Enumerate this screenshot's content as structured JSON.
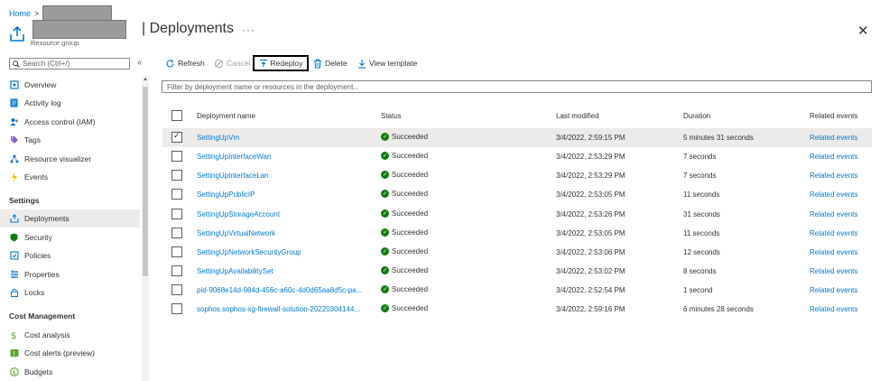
{
  "breadcrumb": {
    "home": "Home",
    "separator": ">"
  },
  "header": {
    "title": "| Deployments",
    "subtitle": "Resource group",
    "more": "···",
    "close": "✕"
  },
  "sidebar": {
    "search_placeholder": "Search (Ctrl+/)",
    "collapse": "«",
    "items_top": [
      {
        "label": "Overview",
        "icon": "overview-icon"
      },
      {
        "label": "Activity log",
        "icon": "activity-log-icon"
      },
      {
        "label": "Access control (IAM)",
        "icon": "access-control-icon"
      },
      {
        "label": "Tags",
        "icon": "tag-icon"
      },
      {
        "label": "Resource visualizer",
        "icon": "visualizer-icon"
      },
      {
        "label": "Events",
        "icon": "events-icon"
      }
    ],
    "section_settings": "Settings",
    "items_settings": [
      {
        "label": "Deployments",
        "icon": "deployments-icon"
      },
      {
        "label": "Security",
        "icon": "security-icon"
      },
      {
        "label": "Policies",
        "icon": "policies-icon"
      },
      {
        "label": "Properties",
        "icon": "properties-icon"
      },
      {
        "label": "Locks",
        "icon": "lock-icon"
      }
    ],
    "section_cost": "Cost Management",
    "items_cost": [
      {
        "label": "Cost analysis",
        "icon": "cost-analysis-icon"
      },
      {
        "label": "Cost alerts (preview)",
        "icon": "cost-alerts-icon"
      },
      {
        "label": "Budgets",
        "icon": "budgets-icon"
      }
    ]
  },
  "toolbar": {
    "refresh": "Refresh",
    "cancel": "Cancel",
    "redeploy": "Redeploy",
    "delete": "Delete",
    "view_template": "View template"
  },
  "filter_placeholder": "Filter by deployment name or resources in the deployment...",
  "table": {
    "columns": [
      "Deployment name",
      "Status",
      "Last modified",
      "Duration",
      "Related events"
    ],
    "rows": [
      {
        "name": "SettingUpVm",
        "status": "Succeeded",
        "modified": "3/4/2022, 2:59:15 PM",
        "duration": "5 minutes 31 seconds",
        "events": "Related events",
        "selected": true
      },
      {
        "name": "SettingUpInterfaceWan",
        "status": "Succeeded",
        "modified": "3/4/2022, 2:53:29 PM",
        "duration": "7 seconds",
        "events": "Related events",
        "selected": false
      },
      {
        "name": "SettingUpInterfaceLan",
        "status": "Succeeded",
        "modified": "3/4/2022, 2:53:29 PM",
        "duration": "7 seconds",
        "events": "Related events",
        "selected": false
      },
      {
        "name": "SettingUpPublicIP",
        "status": "Succeeded",
        "modified": "3/4/2022, 2:53:05 PM",
        "duration": "11 seconds",
        "events": "Related events",
        "selected": false
      },
      {
        "name": "SettingUpStorageAccount",
        "status": "Succeeded",
        "modified": "3/4/2022, 2:53:26 PM",
        "duration": "31 seconds",
        "events": "Related events",
        "selected": false
      },
      {
        "name": "SettingUpVirtualNetwork",
        "status": "Succeeded",
        "modified": "3/4/2022, 2:53:05 PM",
        "duration": "11 seconds",
        "events": "Related events",
        "selected": false
      },
      {
        "name": "SettingUpNetworkSecurityGroup",
        "status": "Succeeded",
        "modified": "3/4/2022, 2:53:06 PM",
        "duration": "12 seconds",
        "events": "Related events",
        "selected": false
      },
      {
        "name": "SettingUpAvailabilitySet",
        "status": "Succeeded",
        "modified": "3/4/2022, 2:53:02 PM",
        "duration": "8 seconds",
        "events": "Related events",
        "selected": false
      },
      {
        "name": "pid-9068e14d-984d-456c-a60c-4d0d65aa8d5c-pa...",
        "status": "Succeeded",
        "modified": "3/4/2022, 2:52:54 PM",
        "duration": "1 second",
        "events": "Related events",
        "selected": false
      },
      {
        "name": "sophos.sophos-xg-firewall-solution-20220304144...",
        "status": "Succeeded",
        "modified": "3/4/2022, 2:59:16 PM",
        "duration": "6 minutes 28 seconds",
        "events": "Related events",
        "selected": false
      }
    ]
  },
  "colors": {
    "accent": "#0078d4",
    "success": "#107c10",
    "selected_row": "#edebe9"
  }
}
